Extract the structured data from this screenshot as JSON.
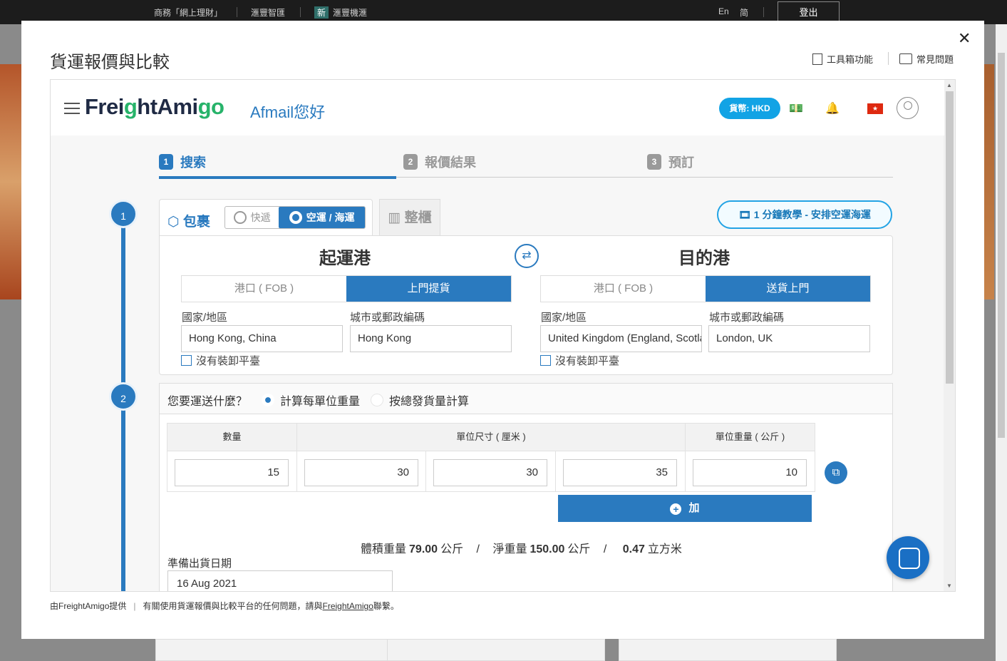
{
  "topbar": {
    "items": [
      "商務「網上理財」",
      "滙豐智匯",
      "滙豐機滙"
    ],
    "new_badge": "新",
    "lang_en": "En",
    "lang_sc": "简",
    "logout": "登出"
  },
  "modal": {
    "title": "貨運報價與比較",
    "close": "✕",
    "toolbox": "工具箱功能",
    "faq": "常見問題"
  },
  "fa_header": {
    "logo_a": "Frei",
    "logo_g1": "g",
    "logo_b": "htAmi",
    "logo_g2": "go",
    "greeting": "Afmail您好",
    "currency": "貨幣: HKD",
    "flag": "★"
  },
  "steps": [
    {
      "num": "1",
      "label": "搜索",
      "active": true
    },
    {
      "num": "2",
      "label": "報價結果",
      "active": false
    },
    {
      "num": "3",
      "label": "預訂",
      "active": false
    }
  ],
  "timeline": [
    "1",
    "2"
  ],
  "shipment_tabs": {
    "parcel": "包裹",
    "express": "快遞",
    "air_sea": "空運 / 海運",
    "fcl": "整櫃"
  },
  "tutorial": "1 分鐘教學 - 安排空運海運",
  "origin": {
    "title": "起運港",
    "mode_port": "港口 ( FOB )",
    "mode_door": "上門提貨",
    "country_label": "國家/地區",
    "country_value": "Hong Kong, China",
    "city_label": "城市或郵政編碼",
    "city_value": "Hong Kong",
    "no_dock": "沒有裝卸平臺"
  },
  "destination": {
    "title": "目的港",
    "mode_port": "港口 ( FOB )",
    "mode_door": "送貨上門",
    "country_label": "國家/地區",
    "country_value": "United Kingdom (England, Scotland)",
    "city_label": "城市或郵政編碼",
    "city_value": "London, UK",
    "no_dock": "沒有裝卸平臺"
  },
  "cargo": {
    "question": "您要運送什麼？",
    "opt_unit": "計算每單位重量",
    "opt_total": "按總發貨量計算",
    "col_qty": "數量",
    "col_dims": "單位尺寸 ( 厘米 )",
    "col_weight": "單位重量 ( 公斤 )",
    "qty": "15",
    "length": "30",
    "width": "30",
    "height": "35",
    "weight": "10",
    "add": "加"
  },
  "summary": {
    "vol_label": "體積重量",
    "vol_value": "79.00",
    "vol_unit": "公斤",
    "net_label": "淨重量",
    "net_value": "150.00",
    "net_unit": "公斤",
    "cbm_value": "0.47",
    "cbm_unit": "立方米"
  },
  "ready_date": {
    "label": "準備出貨日期",
    "value": "16 Aug 2021"
  },
  "footer": {
    "provided": "由FreightAmigo提供",
    "notice_a": "有關使用貨運報價與比較平台的任何問題，請與",
    "link": "FreightAmigo",
    "notice_b": "聯繫。"
  },
  "colors": {
    "primary": "#2a7abf",
    "currency": "#12a3e5",
    "logo_dark": "#1f2a44",
    "logo_green": "#27b36a"
  }
}
